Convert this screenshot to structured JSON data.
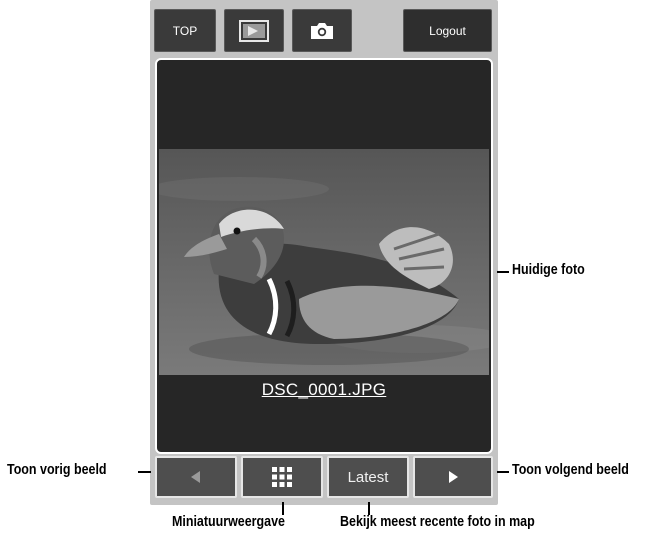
{
  "toolbar": {
    "top_label": "TOP",
    "playback_icon": "playback-icon",
    "camera_icon": "camera-icon",
    "logout_label": "Logout"
  },
  "viewer": {
    "filename": "DSC_0001.JPG"
  },
  "nav": {
    "prev_icon": "triangle-left-icon",
    "thumbnails_icon": "grid-icon",
    "latest_label": "Latest",
    "next_icon": "triangle-right-icon"
  },
  "callouts": {
    "current_photo": "Huidige foto",
    "prev_image": "Toon vorig beeld",
    "next_image": "Toon volgend beeld",
    "thumbnails": "Miniatuurweergave",
    "latest": "Bekijk meest recente foto in map"
  }
}
